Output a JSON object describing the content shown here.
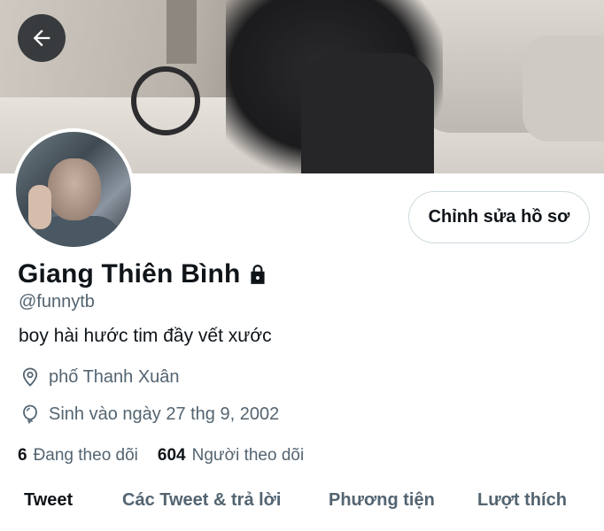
{
  "header": {
    "back_icon": "arrow-left-icon"
  },
  "profile": {
    "name": "Giang Thiên Bình",
    "lock_icon": "lock-icon",
    "handle": "@funnytb",
    "bio": "boy hài hước tim đầy vết xước",
    "location_icon": "location-pin-icon",
    "location": "phố Thanh Xuân",
    "birthday_icon": "balloon-icon",
    "birthday": "Sinh vào ngày 27 thg 9, 2002",
    "following_count": "6",
    "following_label": "Đang theo dõi",
    "followers_count": "604",
    "followers_label": "Người theo dõi"
  },
  "actions": {
    "edit_profile_label": "Chỉnh sửa hồ sơ"
  },
  "tabs": [
    {
      "label": "Tweet",
      "active": true
    },
    {
      "label": "Các Tweet & trả lời",
      "active": false
    },
    {
      "label": "Phương tiện",
      "active": false
    },
    {
      "label": "Lượt thích",
      "active": false
    }
  ],
  "colors": {
    "text_primary": "#0f1419",
    "text_secondary": "#536471",
    "border": "#cfd9de"
  }
}
